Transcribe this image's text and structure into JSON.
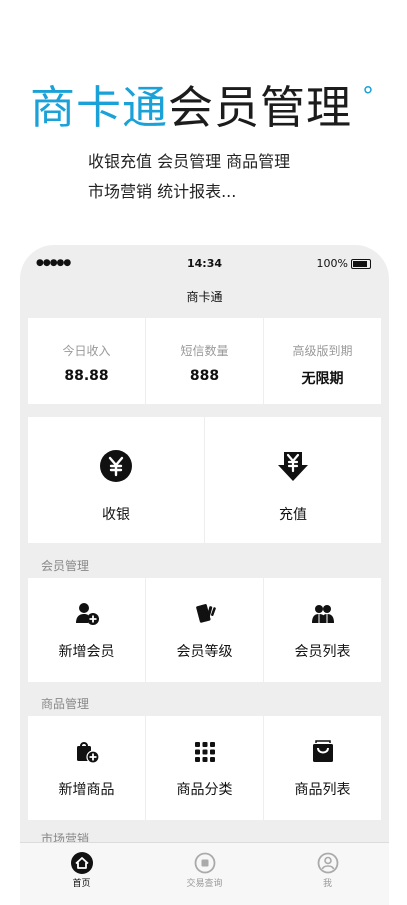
{
  "header": {
    "brand": "商卡通",
    "rest": "会员管理",
    "degree": "°",
    "tagline1": "收银充值  会员管理  商品管理",
    "tagline2": "市场营销  统计报表..."
  },
  "status_bar": {
    "signal": "●●●●●",
    "time": "14:34",
    "battery": "100%"
  },
  "nav": {
    "title": "商卡通"
  },
  "stats": [
    {
      "label": "今日收入",
      "value": "88.88"
    },
    {
      "label": "短信数量",
      "value": "888"
    },
    {
      "label": "高级版到期",
      "value": "无限期"
    }
  ],
  "actions": [
    {
      "label": "收银",
      "icon": "yen-circle-icon"
    },
    {
      "label": "充值",
      "icon": "yen-down-arrow-icon"
    }
  ],
  "sections": {
    "member": "会员管理",
    "goods": "商品管理",
    "marketing": "市场营销"
  },
  "member_items": [
    {
      "label": "新增会员",
      "icon": "add-user-icon"
    },
    {
      "label": "会员等级",
      "icon": "cards-icon"
    },
    {
      "label": "会员列表",
      "icon": "users-icon"
    }
  ],
  "goods_items": [
    {
      "label": "新增商品",
      "icon": "add-bag-icon"
    },
    {
      "label": "商品分类",
      "icon": "grid-icon"
    },
    {
      "label": "商品列表",
      "icon": "box-icon"
    }
  ],
  "tabs": [
    {
      "label": "首页",
      "icon": "home-icon",
      "active": true
    },
    {
      "label": "交易查询",
      "icon": "record-icon",
      "active": false
    },
    {
      "label": "我",
      "icon": "profile-icon",
      "active": false
    }
  ],
  "colors": {
    "brand": "#1aa1d8",
    "background": "#eeeeee"
  }
}
